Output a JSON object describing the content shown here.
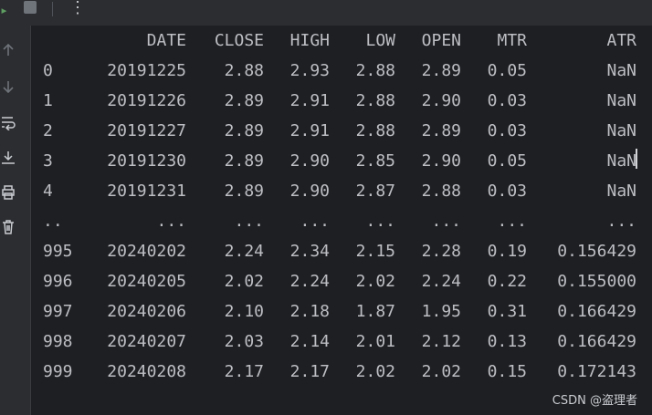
{
  "toolbar": {
    "icons": [
      "run-icon",
      "stop-icon",
      "more-icon"
    ]
  },
  "gutter": {
    "icons": [
      "scroll-up-icon",
      "scroll-down-icon",
      "soft-wrap-icon",
      "scroll-to-end-icon",
      "print-icon",
      "clear-icon"
    ]
  },
  "table": {
    "columns": [
      "DATE",
      "CLOSE",
      "HIGH",
      "LOW",
      "OPEN",
      "MTR",
      "ATR"
    ],
    "rows": [
      [
        "0",
        "20191225",
        "2.88",
        "2.93",
        "2.88",
        "2.89",
        "0.05",
        "NaN"
      ],
      [
        "1",
        "20191226",
        "2.89",
        "2.91",
        "2.88",
        "2.90",
        "0.03",
        "NaN"
      ],
      [
        "2",
        "20191227",
        "2.89",
        "2.91",
        "2.88",
        "2.89",
        "0.03",
        "NaN"
      ],
      [
        "3",
        "20191230",
        "2.89",
        "2.90",
        "2.85",
        "2.90",
        "0.05",
        "NaN"
      ],
      [
        "4",
        "20191231",
        "2.89",
        "2.90",
        "2.87",
        "2.88",
        "0.03",
        "NaN"
      ],
      [
        "..",
        "...",
        "...",
        "...",
        "...",
        "...",
        "...",
        "..."
      ],
      [
        "995",
        "20240202",
        "2.24",
        "2.34",
        "2.15",
        "2.28",
        "0.19",
        "0.156429"
      ],
      [
        "996",
        "20240205",
        "2.02",
        "2.24",
        "2.02",
        "2.24",
        "0.22",
        "0.155000"
      ],
      [
        "997",
        "20240206",
        "2.10",
        "2.18",
        "1.87",
        "1.95",
        "0.31",
        "0.166429"
      ],
      [
        "998",
        "20240207",
        "2.03",
        "2.14",
        "2.01",
        "2.12",
        "0.13",
        "0.166429"
      ],
      [
        "999",
        "20240208",
        "2.17",
        "2.17",
        "2.02",
        "2.02",
        "0.15",
        "0.172143"
      ]
    ]
  },
  "watermark": "CSDN @盗理者",
  "colors": {
    "text": "#bcbec4",
    "background": "#1e1f22",
    "panel": "#2b2d30"
  }
}
